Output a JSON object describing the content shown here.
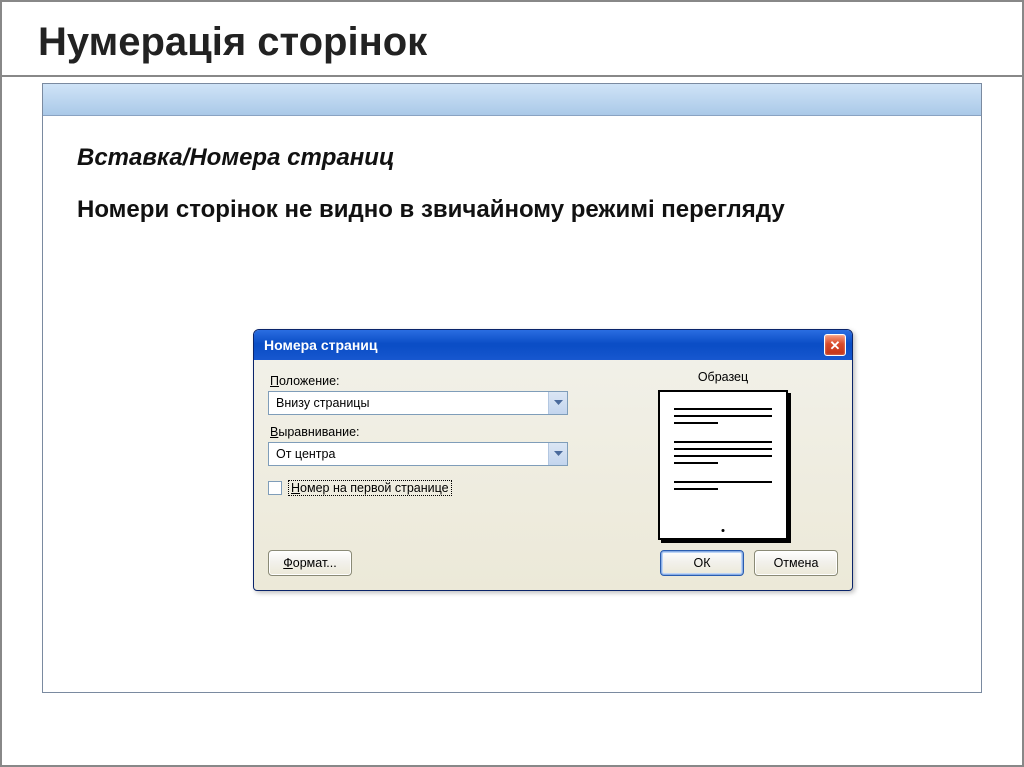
{
  "slide": {
    "title": "Нумерація сторінок",
    "subtitle": "Вставка/Номера страниц",
    "paragraph": "Номери сторінок не видно в звичайному режимі перегляду"
  },
  "dialog": {
    "title": "Номера страниц",
    "position": {
      "label_prefix": "П",
      "label_rest": "оложение:",
      "value": "Внизу страницы"
    },
    "alignment": {
      "label_prefix": "В",
      "label_rest": "ыравнивание:",
      "value": "От центра"
    },
    "checkbox": {
      "label_prefix": "Н",
      "label_rest": "омер на первой странице"
    },
    "sample_label": "Образец",
    "buttons": {
      "format_prefix": "Ф",
      "format_rest": "ормат...",
      "ok": "ОК",
      "cancel": "Отмена"
    }
  }
}
